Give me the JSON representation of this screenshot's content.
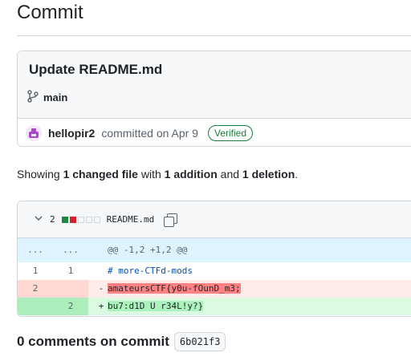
{
  "page": {
    "title": "Commit"
  },
  "commit": {
    "message": "Update README.md",
    "branch": "main",
    "author": "hellopir2",
    "committed_text": "committed on Apr 9",
    "verified_label": "Verified"
  },
  "summary": {
    "prefix": "Showing",
    "changed": "1 changed file",
    "with": "with",
    "additions": "1 addition",
    "and": "and",
    "deletions": "1 deletion",
    "end": "."
  },
  "file": {
    "count": "2",
    "name": "README.md",
    "hunk_header": "@@ -1,2 +1,2 @@",
    "hunk_left": "...",
    "hunk_right": "...",
    "lines": [
      {
        "type": "context",
        "old": "1",
        "new": "1",
        "sign": "",
        "text": "# more-CTFd-mods"
      },
      {
        "type": "deletion",
        "old": "2",
        "new": "",
        "sign": "-",
        "text": "amateursCTF{y0u-fOunD_m3;"
      },
      {
        "type": "addition",
        "old": "",
        "new": "2",
        "sign": "+",
        "text": "bu7:d1D U r34L!y?}"
      }
    ]
  },
  "comments": {
    "label": "0 comments on commit",
    "sha": "6b021f3"
  },
  "colors": {
    "accent_green": "#1a7f37",
    "deletion_bg": "#ffebe9",
    "addition_bg": "#dafbe1",
    "hunk_bg": "#ddf4ff"
  },
  "icons": [
    "git-branch-icon",
    "avatar-icon",
    "chevron-down-icon",
    "copy-icon"
  ]
}
